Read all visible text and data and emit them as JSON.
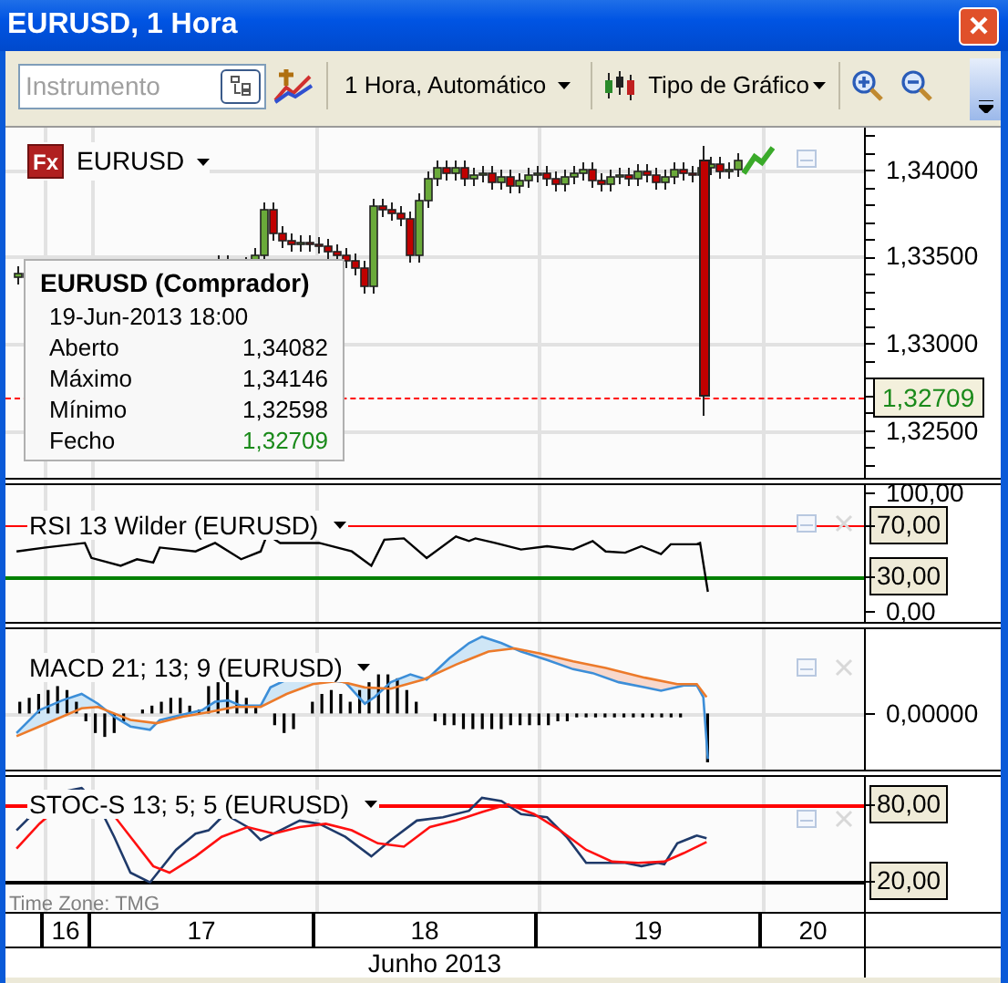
{
  "window": {
    "title": "EURUSD, 1 Hora"
  },
  "toolbar": {
    "instrument": {
      "placeholder": "Instrumento"
    },
    "timeframe": "1 Hora, Automático",
    "chart_type": "Tipo de Gráfico"
  },
  "price_panel": {
    "symbol_badge": "Fx",
    "symbol": "EURUSD",
    "axis_labels": [
      "1,34000",
      "1,33500",
      "1,33000",
      "1,32500"
    ],
    "last_price": "1,32709",
    "tooltip": {
      "title": "EURUSD (Comprador)",
      "datetime": "19-Jun-2013 18:00",
      "rows": [
        {
          "label": "Aberto",
          "value": "1,34082",
          "kind": "plain"
        },
        {
          "label": "Máximo",
          "value": "1,34146",
          "kind": "plain"
        },
        {
          "label": "Mínimo",
          "value": "1,32598",
          "kind": "plain"
        },
        {
          "label": "Fecho",
          "value": "1,32709",
          "kind": "close"
        }
      ]
    }
  },
  "indicators": [
    {
      "kind": "rsi",
      "title": "RSI 13 Wilder (EURUSD)",
      "axis_labels": [
        "100,00",
        "0,00"
      ],
      "levels": [
        {
          "text": "70,00",
          "color": "#ff0000"
        },
        {
          "text": "30,00",
          "color": "#008000"
        }
      ]
    },
    {
      "kind": "macd",
      "title": "MACD 21; 13; 9 (EURUSD)",
      "axis_labels": [
        "0,00000"
      ]
    },
    {
      "kind": "stoc",
      "title": "STOC-S 13; 5; 5 (EURUSD)",
      "levels": [
        {
          "text": "80,00",
          "color": "#ff0000"
        },
        {
          "text": "20,00",
          "color": "#000000"
        }
      ]
    }
  ],
  "time_zone": "Time Zone: TMG",
  "time_axis": {
    "days": [
      "16",
      "17",
      "18",
      "19",
      "20"
    ],
    "month": "Junho 2013"
  }
}
